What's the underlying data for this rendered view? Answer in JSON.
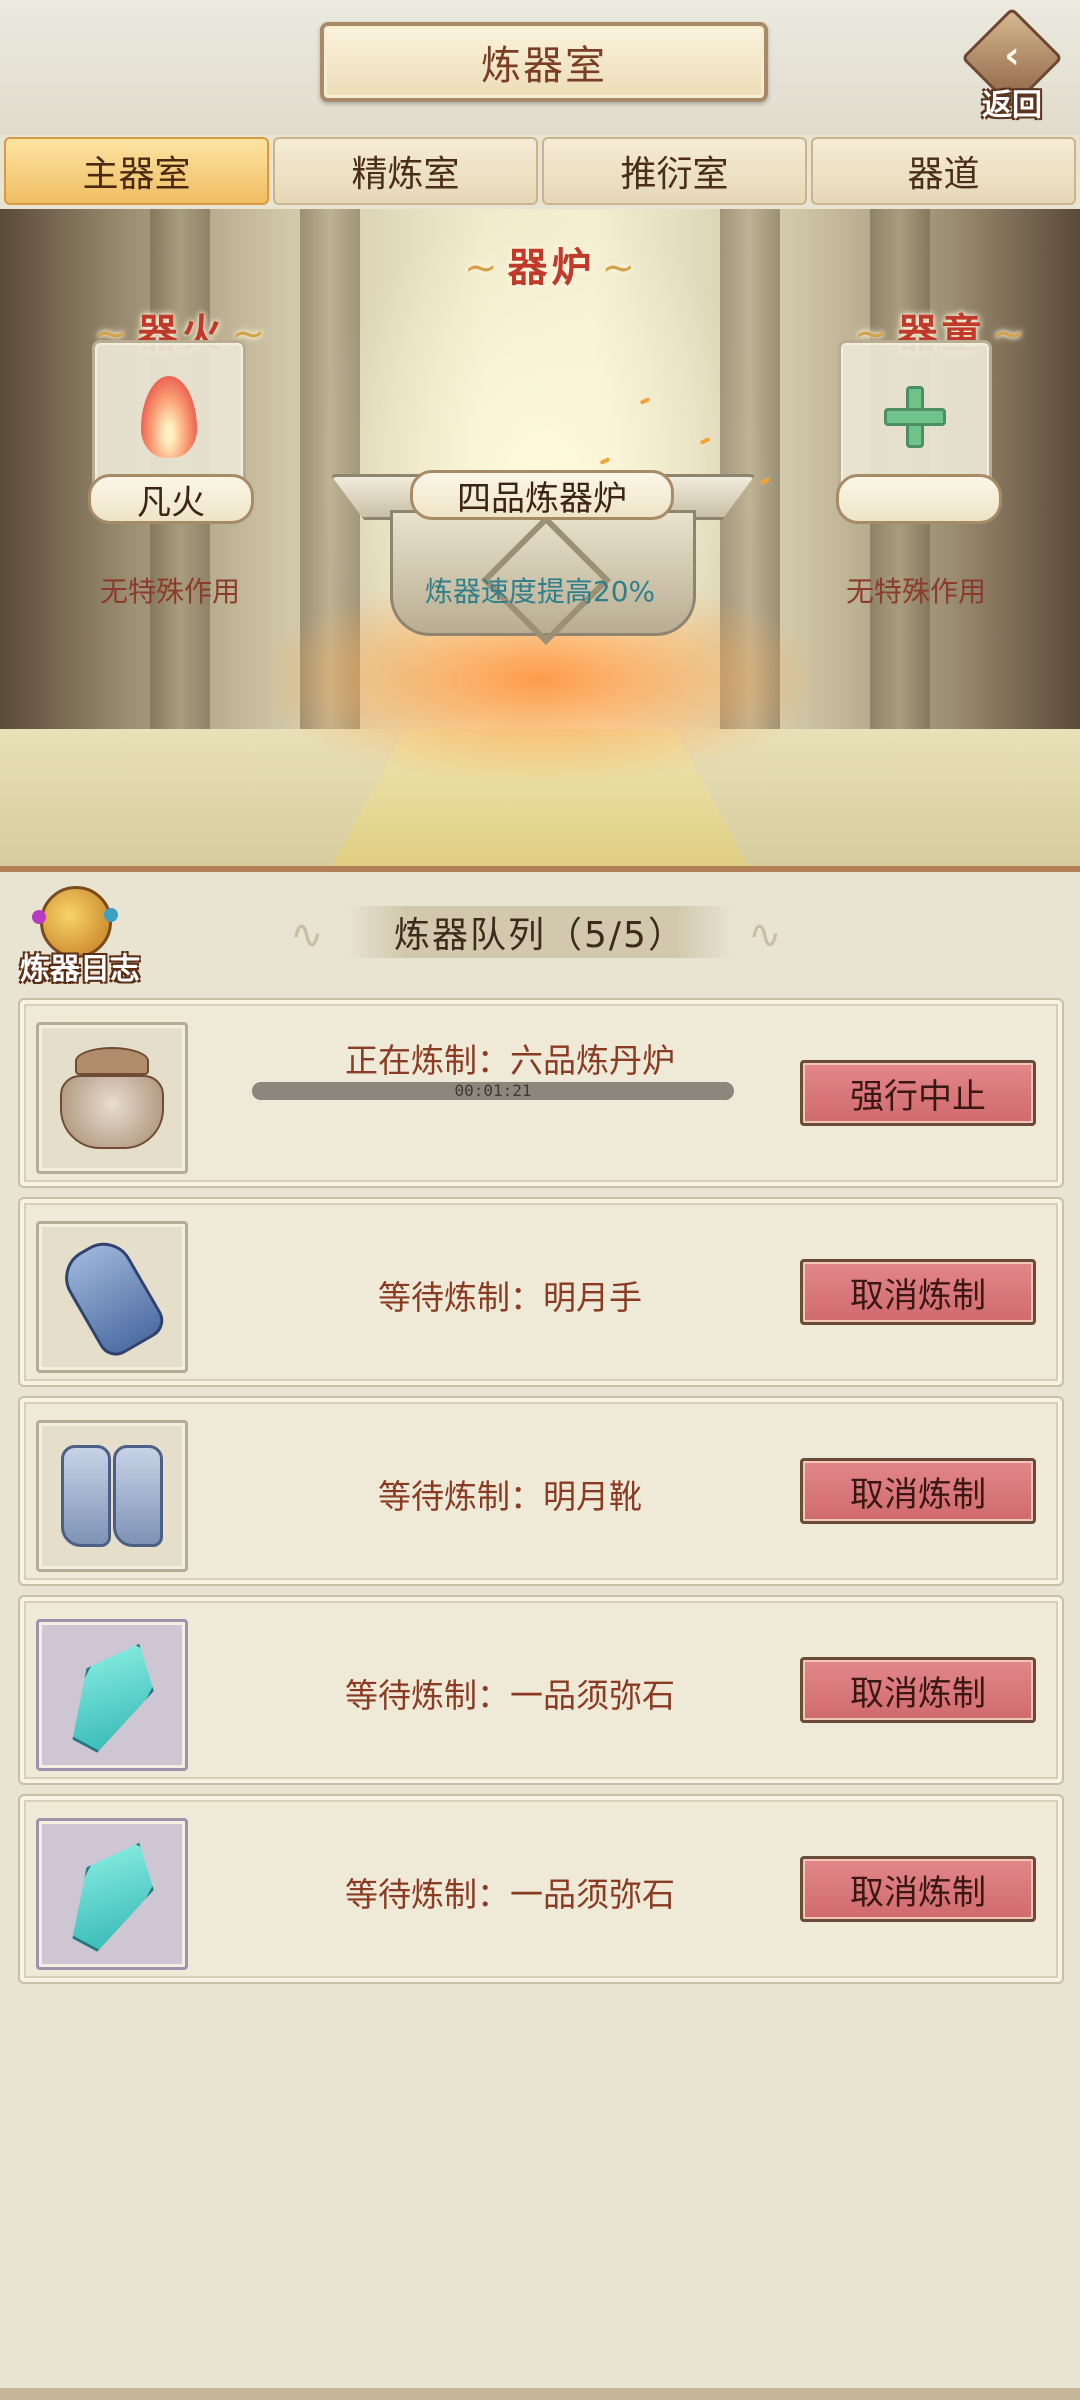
{
  "header": {
    "title": "炼器室",
    "back_label": "返回"
  },
  "tabs": [
    {
      "label": "主器室",
      "active": true
    },
    {
      "label": "精炼室",
      "active": false
    },
    {
      "label": "推衍室",
      "active": false
    },
    {
      "label": "器道",
      "active": false
    }
  ],
  "scene": {
    "fire": {
      "label": "器火",
      "name": "凡火",
      "effect": "无特殊作用",
      "icon": "flame-icon"
    },
    "furnace": {
      "label": "器炉",
      "name": "四品炼器炉",
      "effect": "炼器速度提高20%"
    },
    "servant": {
      "label": "器童",
      "name": "",
      "effect": "无特殊作用",
      "icon": "plus-icon"
    }
  },
  "queue": {
    "log_label": "炼器日志",
    "title": "炼器队列（5/5）",
    "items": [
      {
        "status": "正在炼制：六品炼丹炉",
        "time": "00:01:21",
        "button": "强行中止",
        "icon": "alchemy-furnace-icon"
      },
      {
        "status": "等待炼制：明月手",
        "button": "取消炼制",
        "icon": "gauntlet-icon"
      },
      {
        "status": "等待炼制：明月靴",
        "button": "取消炼制",
        "icon": "boots-icon"
      },
      {
        "status": "等待炼制：一品须弥石",
        "button": "取消炼制",
        "icon": "crystal-icon"
      },
      {
        "status": "等待炼制：一品须弥石",
        "button": "取消炼制",
        "icon": "crystal-icon"
      }
    ]
  },
  "colors": {
    "accent_tab": "#f0bd63",
    "button_red": "#d9777a",
    "text_brown": "#8a3b23",
    "effect_teal": "#2f7f8b"
  }
}
